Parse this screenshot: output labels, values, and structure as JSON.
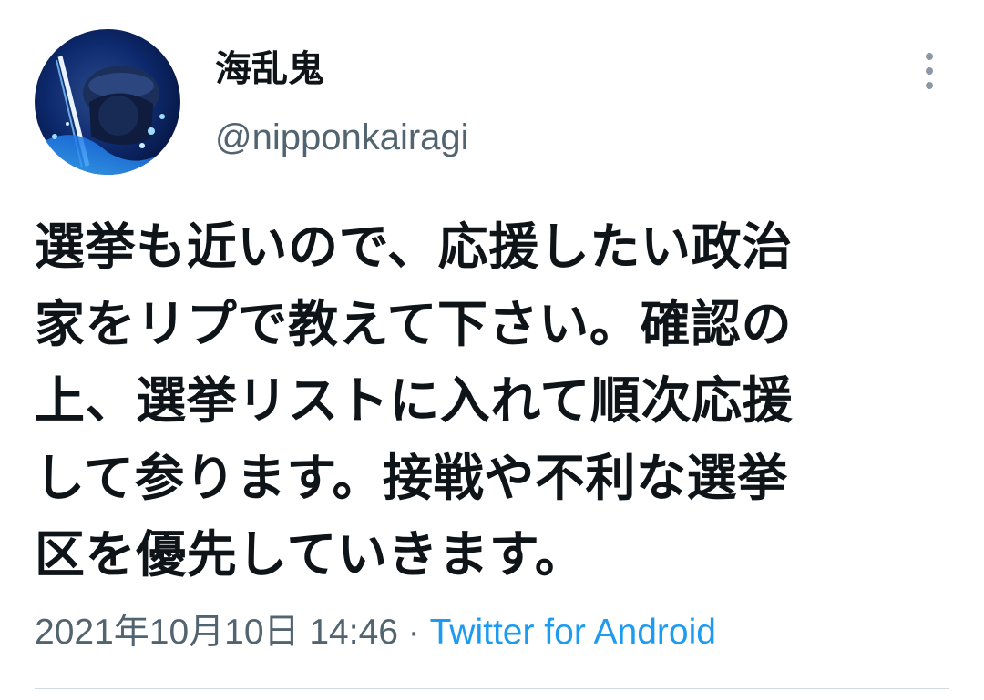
{
  "tweet": {
    "author": {
      "display_name": "海乱鬼",
      "handle": "@nipponkairagi",
      "avatar_icon": "avatar-image"
    },
    "more_icon": "more-vertical-icon",
    "text_lines": [
      "選挙も近いので、応援したい政治",
      "家をリプで教えて下さい。確認の",
      "上、選挙リストに入れて順次応援",
      "して参ります。接戦や不利な選挙",
      "区を優先していきます。"
    ],
    "timestamp": "2021年10月10日 14:46",
    "separator": " · ",
    "source": "Twitter for Android"
  },
  "colors": {
    "text_primary": "#0f1419",
    "text_secondary": "#536471",
    "link": "#1d9bf0",
    "divider": "#d4dbe0"
  }
}
